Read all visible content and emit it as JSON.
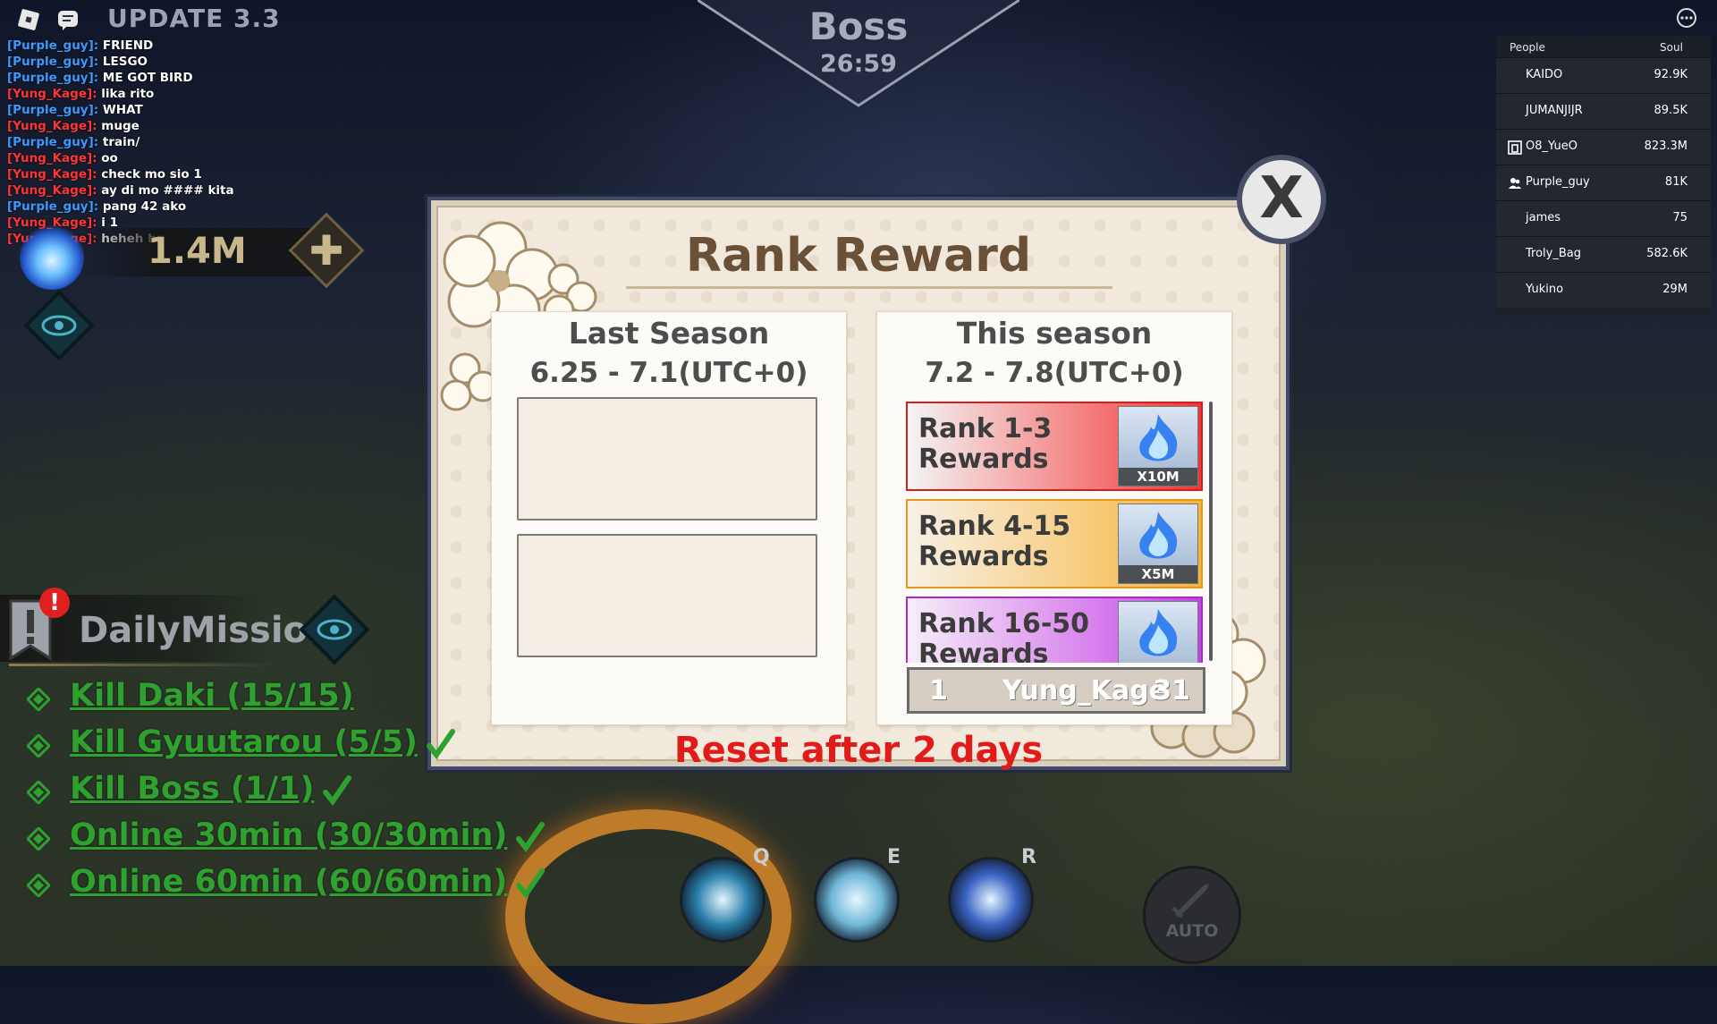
{
  "hud": {
    "update_label": "UPDATE 3.3",
    "currency": "1.4M",
    "plus_symbol": "✚"
  },
  "chat": [
    {
      "name": "[Purple_guy]:",
      "color": "blue",
      "msg": "FRIEND"
    },
    {
      "name": "[Purple_guy]:",
      "color": "blue",
      "msg": "LESGO"
    },
    {
      "name": "[Purple_guy]:",
      "color": "blue",
      "msg": "ME GOT BIRD"
    },
    {
      "name": "[Yung_Kage]:",
      "color": "red",
      "msg": "lika rito"
    },
    {
      "name": "[Purple_guy]:",
      "color": "blue",
      "msg": "WHAT"
    },
    {
      "name": "[Yung_Kage]:",
      "color": "red",
      "msg": "muge"
    },
    {
      "name": "[Purple_guy]:",
      "color": "blue",
      "msg": "train/"
    },
    {
      "name": "[Yung_Kage]:",
      "color": "red",
      "msg": "oo"
    },
    {
      "name": "[Yung_Kage]:",
      "color": "red",
      "msg": "check mo sio 1"
    },
    {
      "name": "[Yung_Kage]:",
      "color": "red",
      "msg": "ay di mo #### kita"
    },
    {
      "name": "[Purple_guy]:",
      "color": "blue",
      "msg": "pang 42 ako"
    },
    {
      "name": "[Yung_Kage]:",
      "color": "red",
      "msg": "i 1"
    },
    {
      "name": "[Yung_Kage]:",
      "color": "red",
      "msg": "heheh ha"
    }
  ],
  "boss": {
    "title": "Boss",
    "timer": "26:59"
  },
  "leaderboard": {
    "col_people": "People",
    "col_soul": "Soul",
    "rows": [
      {
        "name": "KAIDO",
        "soul": "92.9K",
        "icon": ""
      },
      {
        "name": "JUMANJIJR",
        "soul": "89.5K",
        "icon": ""
      },
      {
        "name": "O8_YueO",
        "soul": "823.3M",
        "icon": "premium-icon"
      },
      {
        "name": "Purple_guy",
        "soul": "81K",
        "icon": "friends-icon"
      },
      {
        "name": "james",
        "soul": "75",
        "icon": ""
      },
      {
        "name": "Troly_Bag",
        "soul": "582.6K",
        "icon": ""
      },
      {
        "name": "Yukino",
        "soul": "29M",
        "icon": ""
      }
    ]
  },
  "modal": {
    "title": "Rank Reward",
    "close_label": "X",
    "last_season": {
      "title": "Last Season",
      "range": "6.25 - 7.1(UTC+0)"
    },
    "this_season": {
      "title": "This season",
      "range": "7.2 - 7.8(UTC+0)",
      "rewards": [
        {
          "line1": "Rank 1-3",
          "line2": "Rewards",
          "qty": "X10M",
          "color_from": "#f4f4f4",
          "color_to": "#f43434",
          "border": "#d11f1f"
        },
        {
          "line1": "Rank 4-15",
          "line2": "Rewards",
          "qty": "X5M",
          "color_from": "#f7f1e6",
          "color_to": "#f7b43a",
          "border": "#e39a1c"
        },
        {
          "line1": "Rank 16-50",
          "line2": "Rewards",
          "qty": "",
          "color_from": "#f6eef8",
          "color_to": "#c642e6",
          "border": "#a52cc6"
        }
      ],
      "my_rank": {
        "rank": "1",
        "name": "Yung_Kage",
        "score": "31"
      }
    },
    "reset_text": "Reset after 2 days"
  },
  "daily_mission": {
    "title": "DailyMission",
    "alert": "!",
    "missions": [
      {
        "text": "Kill Daki (15/15)",
        "done": false
      },
      {
        "text": "Kill Gyuutarou (5/5)",
        "done": true
      },
      {
        "text": "Kill Boss (1/1)",
        "done": true
      },
      {
        "text": "Online 30min (30/30min)",
        "done": true
      },
      {
        "text": "Online 60min (60/60min)",
        "done": true
      }
    ]
  },
  "skills": [
    {
      "key": "Q",
      "color": "#2a7fa8"
    },
    {
      "key": "E",
      "color": "#6fb7d8"
    },
    {
      "key": "R",
      "color": "#3a63c4"
    }
  ],
  "auto_label": "AUTO"
}
